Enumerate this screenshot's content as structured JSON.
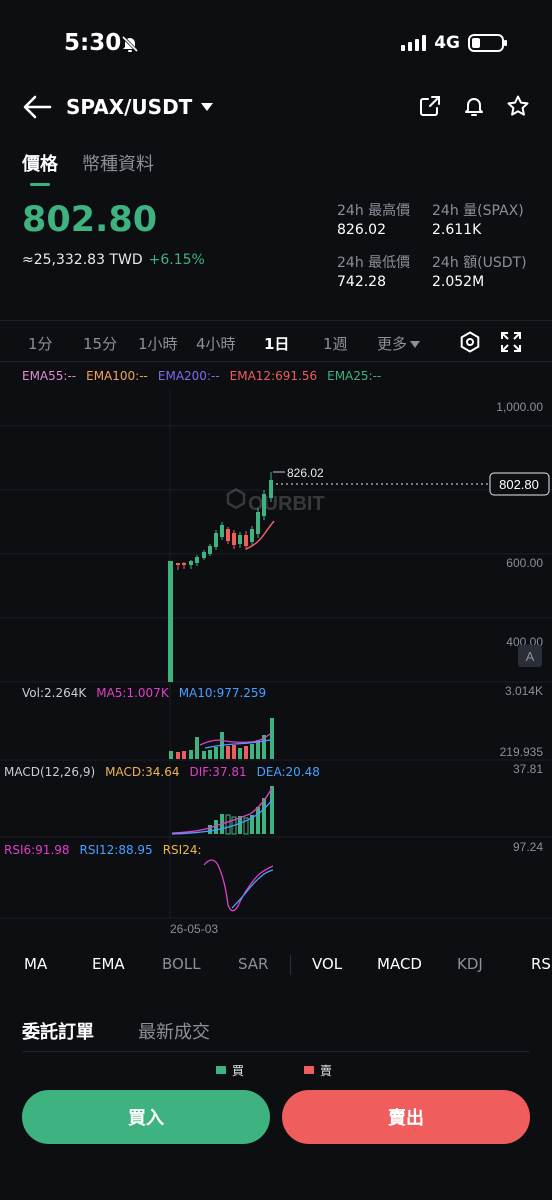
{
  "status": {
    "time": "5:30",
    "network": "4G",
    "battery_level": 0.28
  },
  "header": {
    "pair": "SPAX/USDT"
  },
  "tabs": [
    "價格",
    "幣種資料"
  ],
  "price": {
    "last": "802.80",
    "twd": "≈25,332.83 TWD",
    "change": "+6.15%",
    "stats": [
      {
        "label": "24h 最高價",
        "value": "826.02"
      },
      {
        "label": "24h 量(SPAX)",
        "value": "2.611K"
      },
      {
        "label": "24h 最低價",
        "value": "742.28"
      },
      {
        "label": "24h 額(USDT)",
        "value": "2.052M"
      }
    ]
  },
  "intervals": [
    "1分",
    "15分",
    "1小時",
    "4小時",
    "1日",
    "1週",
    "更多"
  ],
  "active_interval": "1日",
  "colors": {
    "up": "#3fb37f",
    "down": "#ef5d5d",
    "accent": "#3fb37f",
    "bg": "#0c0e12"
  },
  "chart": {
    "ema": [
      {
        "label": "EMA55:--",
        "color": "#e08bd0"
      },
      {
        "label": "EMA100:--",
        "color": "#f0a35c"
      },
      {
        "label": "EMA200:--",
        "color": "#7b6cf0"
      },
      {
        "label": "EMA12:691.56",
        "color": "#ef5d5d"
      },
      {
        "label": "EMA25:--",
        "color": "#3fb37f"
      }
    ],
    "price_axis": [
      "1,000.00",
      "600.00",
      "400.00"
    ],
    "high_marker": "826.02",
    "last_price_tag": "802.80",
    "watermark": "OURBIT",
    "axis_mode": "A",
    "vol": {
      "items": [
        {
          "label": "Vol:2.264K",
          "color": "#c9ccd2"
        },
        {
          "label": "MA5:1.007K",
          "color": "#e040c8"
        },
        {
          "label": "MA10:977.259",
          "color": "#4aa0ff"
        }
      ],
      "max": "3.014K",
      "min": "219.935"
    },
    "macd": {
      "items": [
        {
          "label": "MACD(12,26,9)",
          "color": "#c9ccd2"
        },
        {
          "label": "MACD:34.64",
          "color": "#f0b44c"
        },
        {
          "label": "DIF:37.81",
          "color": "#e040c8"
        },
        {
          "label": "DEA:20.48",
          "color": "#4aa0ff"
        }
      ],
      "max": "37.81"
    },
    "rsi": {
      "items": [
        {
          "label": "RSI6:91.98",
          "color": "#e040c8"
        },
        {
          "label": "RSI12:88.95",
          "color": "#4aa0ff"
        },
        {
          "label": "RSI24:",
          "color": "#f0b44c"
        }
      ],
      "max": "97.24"
    },
    "date_label": "26-05-03"
  },
  "indicator_tabs": [
    "MA",
    "EMA",
    "BOLL",
    "SAR",
    "VOL",
    "MACD",
    "KDJ",
    "RS"
  ],
  "orders": {
    "tabs": [
      "委託訂單",
      "最新成交"
    ],
    "legend_buy": "買",
    "legend_sell": "賣"
  },
  "actions": {
    "buy": "買入",
    "sell": "賣出"
  }
}
